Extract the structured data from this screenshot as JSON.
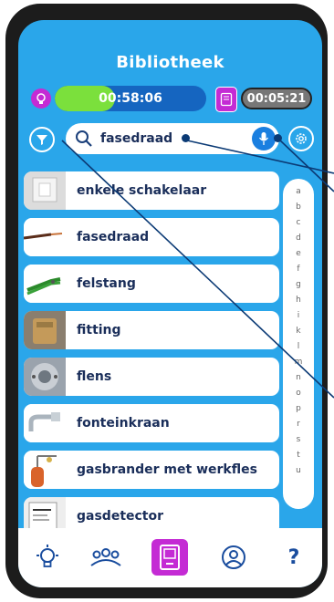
{
  "header": {
    "title": "Bibliotheek"
  },
  "timers": {
    "elapsed": "00:58:06",
    "elapsed_progress": 0.4,
    "remaining": "00:05:21"
  },
  "search": {
    "value": "fasedraad"
  },
  "results": [
    {
      "label": "enkele schakelaar",
      "thumb": "switch-image"
    },
    {
      "label": "fasedraad",
      "thumb": "wire-image"
    },
    {
      "label": "felstang",
      "thumb": "pliers-image"
    },
    {
      "label": "fitting",
      "thumb": "fitting-image"
    },
    {
      "label": "flens",
      "thumb": "flange-image"
    },
    {
      "label": "fonteinkraan",
      "thumb": "faucet-image"
    },
    {
      "label": "gasbrander met werkfles",
      "thumb": "gas-burner-image"
    },
    {
      "label": "gasdetector",
      "thumb": "gas-detector-image"
    }
  ],
  "alphabet": [
    "a",
    "b",
    "c",
    "d",
    "e",
    "f",
    "g",
    "h",
    "i",
    "k",
    "l",
    "m",
    "n",
    "o",
    "p",
    "r",
    "s",
    "t",
    "u"
  ],
  "bottom_nav": {
    "help_label": "?"
  },
  "colors": {
    "screen": "#2aa6ea",
    "accent": "#c42bd4",
    "progress_fill": "#7be03c",
    "text": "#1a2e5a"
  }
}
